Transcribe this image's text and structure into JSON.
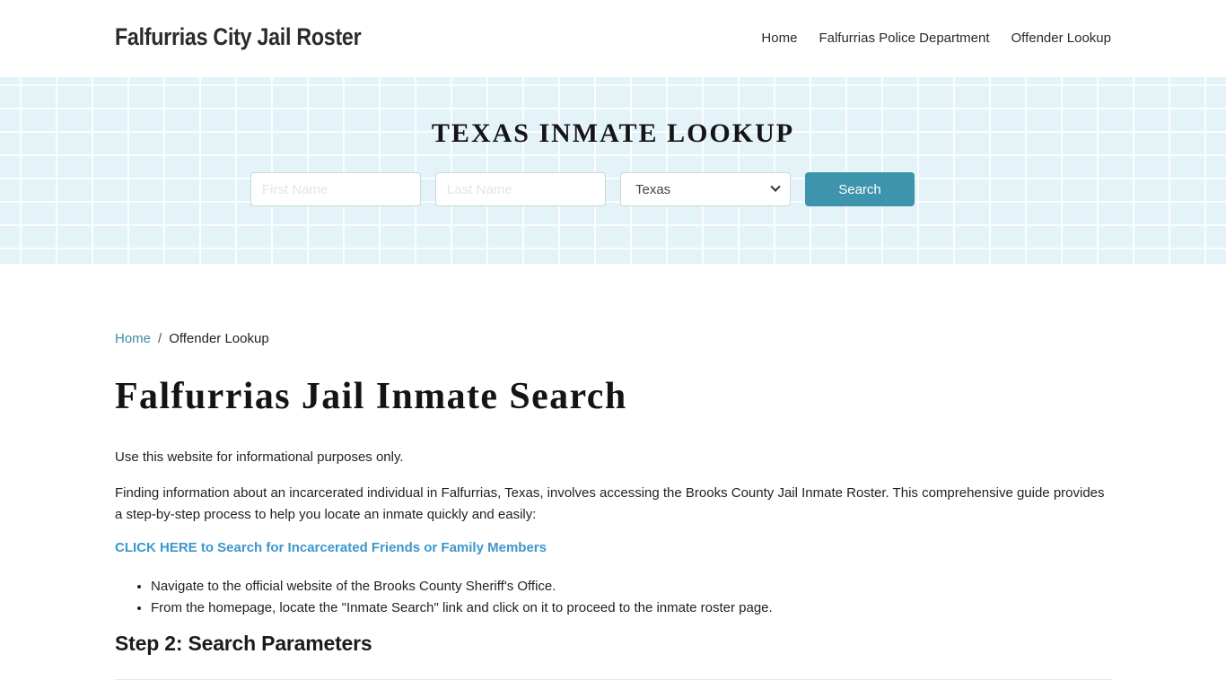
{
  "header": {
    "site_title": "Falfurrias City Jail Roster",
    "nav": [
      {
        "label": "Home"
      },
      {
        "label": "Falfurrias Police Department"
      },
      {
        "label": "Offender Lookup"
      }
    ]
  },
  "hero": {
    "title": "TEXAS INMATE LOOKUP",
    "first_name_placeholder": "First Name",
    "last_name_placeholder": "Last Name",
    "state_selected": "Texas",
    "search_label": "Search"
  },
  "breadcrumb": {
    "home": "Home",
    "separator": "/",
    "current": "Offender Lookup"
  },
  "main": {
    "title": "Falfurrias Jail Inmate Search",
    "paragraphs": [
      "Use this website for informational purposes only.",
      "Finding information about an incarcerated individual in Falfurrias, Texas, involves accessing the Brooks County Jail Inmate Roster. This comprehensive guide provides a step-by-step process to help you locate an inmate quickly and easily:"
    ],
    "cta_link": "CLICK HERE to Search for Incarcerated Friends or Family Members",
    "list_items": [
      "Navigate to the official website of the Brooks County Sheriff's Office.",
      "From the homepage, locate the \"Inmate Search\" link and click on it to proceed to the inmate roster page."
    ],
    "step_heading": "Step 2: Search Parameters"
  },
  "colors": {
    "accent_button": "#3e93ad",
    "link": "#3c97cc",
    "breadcrumb_link": "#3f8aa6",
    "hero_bg": "#e3f3f8"
  }
}
